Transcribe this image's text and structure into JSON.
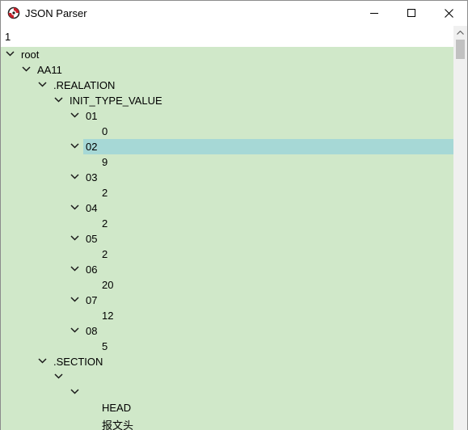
{
  "window": {
    "title": "JSON Parser"
  },
  "search": {
    "value": "1"
  },
  "colors": {
    "tree_background": "#d0e8c9",
    "selection": "#a6d8d6",
    "icon_red": "#c8202a"
  },
  "icons": {
    "app": "app-logo-icon",
    "minimize": "minimize-icon",
    "maximize": "maximize-icon",
    "close": "close-icon",
    "expand": "chevron-down-icon"
  },
  "tree": [
    {
      "label": "root",
      "depth": 0,
      "expander": true
    },
    {
      "label": "AA11",
      "depth": 1,
      "expander": true
    },
    {
      "label": ".REALATION",
      "depth": 2,
      "expander": true
    },
    {
      "label": "INIT_TYPE_VALUE",
      "depth": 3,
      "expander": true
    },
    {
      "label": "01",
      "depth": 4,
      "expander": true
    },
    {
      "label": "0",
      "depth": 5,
      "expander": false
    },
    {
      "label": "02",
      "depth": 4,
      "expander": true,
      "selected": true
    },
    {
      "label": "9",
      "depth": 5,
      "expander": false
    },
    {
      "label": "03",
      "depth": 4,
      "expander": true
    },
    {
      "label": "2",
      "depth": 5,
      "expander": false
    },
    {
      "label": "04",
      "depth": 4,
      "expander": true
    },
    {
      "label": "2",
      "depth": 5,
      "expander": false
    },
    {
      "label": "05",
      "depth": 4,
      "expander": true
    },
    {
      "label": "2",
      "depth": 5,
      "expander": false
    },
    {
      "label": "06",
      "depth": 4,
      "expander": true
    },
    {
      "label": "20",
      "depth": 5,
      "expander": false
    },
    {
      "label": "07",
      "depth": 4,
      "expander": true
    },
    {
      "label": "12",
      "depth": 5,
      "expander": false
    },
    {
      "label": "08",
      "depth": 4,
      "expander": true
    },
    {
      "label": "5",
      "depth": 5,
      "expander": false
    },
    {
      "label": ".SECTION",
      "depth": 2,
      "expander": true
    },
    {
      "label": "",
      "depth": 3,
      "expander": true
    },
    {
      "label": "",
      "depth": 4,
      "expander": true
    },
    {
      "label": "HEAD",
      "depth": 5,
      "expander": false
    },
    {
      "label": "报文头",
      "depth": 5,
      "expander": false
    }
  ]
}
